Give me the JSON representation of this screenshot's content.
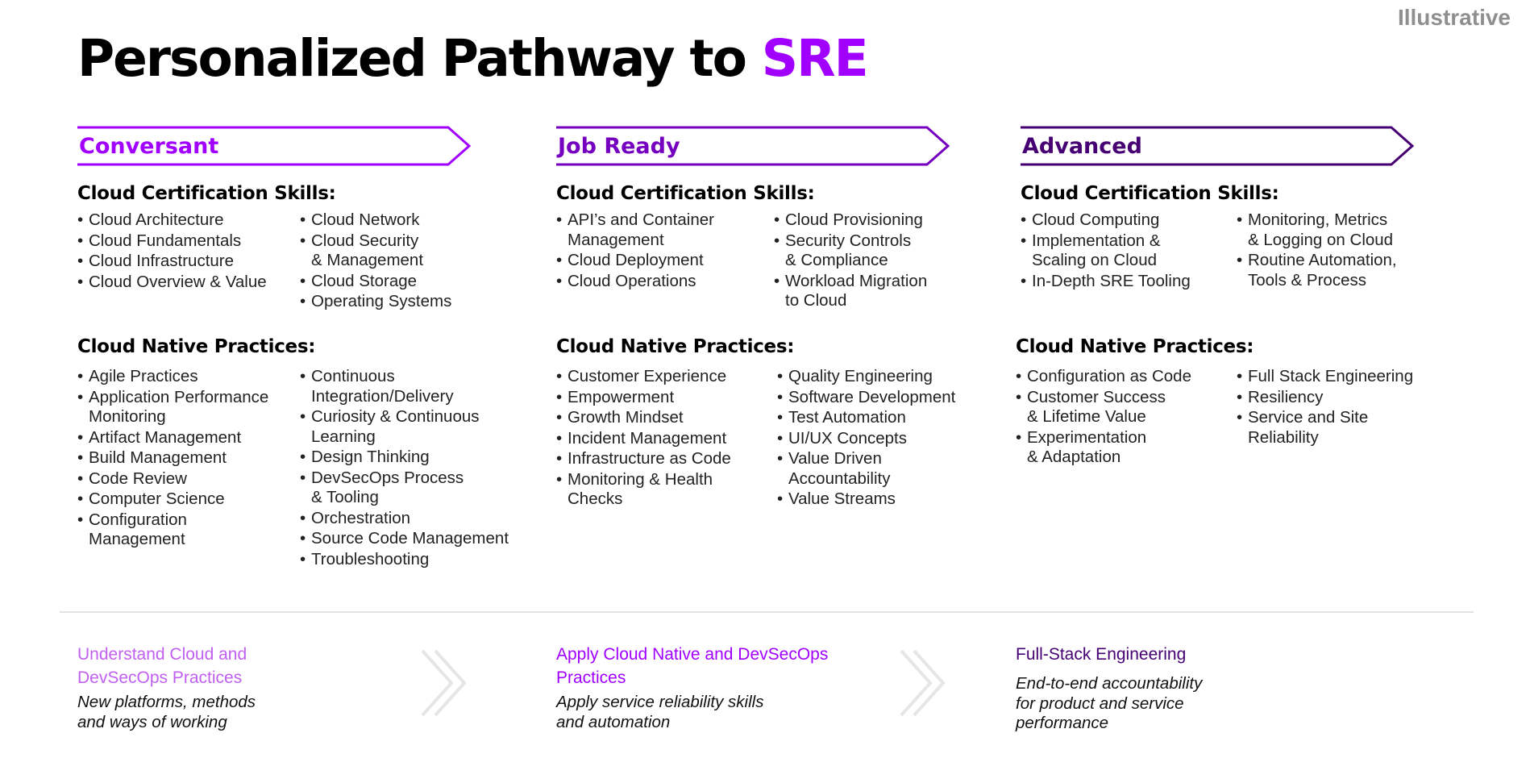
{
  "header": {
    "tag": "Illustrative",
    "title_main": "Personalized Pathway to ",
    "title_accent": "SRE"
  },
  "colors": {
    "conversant": "#a100ff",
    "job_ready": "#7500c0",
    "advanced": "#460073",
    "bottom1_title": "#c160f0",
    "bottom2_title": "#a100ff",
    "bottom3_title": "#460073",
    "chevron": "#e6e6e6"
  },
  "stages": [
    {
      "name": "Conversant",
      "cert_heading": "Cloud Certification Skills:",
      "cert_left": [
        "Cloud Architecture",
        "Cloud Fundamentals",
        "Cloud Infrastructure",
        "Cloud Overview & Value"
      ],
      "cert_right": [
        "Cloud Network",
        "Cloud Security\n& Management",
        "Cloud Storage",
        "Operating Systems"
      ],
      "native_heading": "Cloud Native Practices:",
      "native_left": [
        "Agile Practices",
        "Application Performance\nMonitoring",
        "Artifact Management",
        "Build Management",
        "Code Review",
        "Computer Science",
        "Configuration\nManagement"
      ],
      "native_right": [
        "Continuous\nIntegration/Delivery",
        "Curiosity & Continuous\nLearning",
        "Design Thinking",
        "DevSecOps Process\n& Tooling",
        "Orchestration",
        "Source Code Management",
        "Troubleshooting"
      ]
    },
    {
      "name": "Job Ready",
      "cert_heading": "Cloud Certification Skills:",
      "cert_left": [
        "API’s and Container\nManagement",
        "Cloud Deployment",
        "Cloud Operations"
      ],
      "cert_right": [
        "Cloud Provisioning",
        "Security Controls\n& Compliance",
        "Workload Migration\nto Cloud"
      ],
      "native_heading": "Cloud Native Practices:",
      "native_left": [
        "Customer Experience",
        "Empowerment",
        "Growth Mindset",
        "Incident Management",
        "Infrastructure as Code",
        "Monitoring & Health\nChecks"
      ],
      "native_right": [
        "Quality Engineering",
        "Software Development",
        "Test Automation",
        "UI/UX Concepts",
        "Value Driven\nAccountability",
        "Value Streams"
      ]
    },
    {
      "name": "Advanced",
      "cert_heading": "Cloud Certification Skills:",
      "cert_left": [
        "Cloud Computing",
        "Implementation &\nScaling on Cloud",
        "In-Depth SRE Tooling"
      ],
      "cert_right": [
        "Monitoring, Metrics\n& Logging on Cloud",
        "Routine Automation,\nTools & Process"
      ],
      "native_heading": "Cloud Native Practices:",
      "native_left": [
        "Configuration as Code",
        "Customer Success\n& Lifetime Value",
        "Experimentation\n& Adaptation"
      ],
      "native_right": [
        "Full Stack Engineering",
        "Resiliency",
        "Service and Site\nReliability"
      ]
    }
  ],
  "bottom": [
    {
      "title": "Understand Cloud and\nDevSecOps Practices",
      "subtitle": "New platforms, methods\nand ways of working"
    },
    {
      "title": "Apply Cloud Native and DevSecOps\nPractices",
      "subtitle": "Apply service reliability skills\nand automation"
    },
    {
      "title": "Full-Stack Engineering",
      "subtitle": "End-to-end accountability\nfor product and service\nperformance"
    }
  ],
  "icons": [
    "double-chevron-right-icon",
    "double-chevron-right-icon"
  ]
}
